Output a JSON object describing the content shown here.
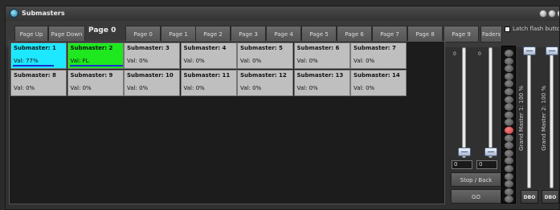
{
  "window": {
    "title": "Submasters"
  },
  "pagebar": {
    "page_up": "Page Up",
    "page_down": "Page Down",
    "current_page": "Page 0",
    "pages": [
      "Page 0",
      "Page 1",
      "Page 2",
      "Page 3",
      "Page 4",
      "Page 5",
      "Page 6",
      "Page 7",
      "Page 8",
      "Page 9"
    ],
    "faders_button": "Faders",
    "latch_label": "Latch flash buttons"
  },
  "submasters": [
    {
      "name": "Submaster: 1",
      "value": "Val: 77%",
      "level": 0.77,
      "color": "#1ee8ff"
    },
    {
      "name": "Submaster: 2",
      "value": "Val: FL",
      "level": 1.0,
      "color": "#1ee81e"
    },
    {
      "name": "Submaster: 3",
      "value": "Val: 0%",
      "level": 0
    },
    {
      "name": "Submaster: 4",
      "value": "Val: 0%",
      "level": 0
    },
    {
      "name": "Submaster: 5",
      "value": "Val: 0%",
      "level": 0
    },
    {
      "name": "Submaster: 6",
      "value": "Val: 0%",
      "level": 0
    },
    {
      "name": "Submaster: 7",
      "value": "Val: 0%",
      "level": 0
    },
    {
      "name": "Submaster: 8",
      "value": "Val: 0%",
      "level": 0
    },
    {
      "name": "Submaster: 9",
      "value": "Val: 0%",
      "level": 0
    },
    {
      "name": "Submaster: 10",
      "value": "Val: 0%",
      "level": 0
    },
    {
      "name": "Submaster: 11",
      "value": "Val: 0%",
      "level": 0
    },
    {
      "name": "Submaster: 12",
      "value": "Val: 0%",
      "level": 0
    },
    {
      "name": "Submaster: 13",
      "value": "Val: 0%",
      "level": 0
    },
    {
      "name": "Submaster: 14",
      "value": "Val: 0%",
      "level": 0
    }
  ],
  "faders": {
    "fader1": {
      "scale_label": "0",
      "value": "0"
    },
    "fader2": {
      "scale_label": "0",
      "value": "0"
    },
    "stop_back": "Stop / Back",
    "go": "GO"
  },
  "grand_masters": [
    {
      "label": "Grand Master 1: 100 %",
      "level": 1.0,
      "dbo": "DBO"
    },
    {
      "label": "Grand Master 2: 100 %",
      "level": 1.0,
      "dbo": "DBO"
    }
  ],
  "colors": {
    "bar_blue": "#1a2fd0",
    "cell_grey": "#bfbfbf",
    "led_red": "#d63a3a"
  }
}
